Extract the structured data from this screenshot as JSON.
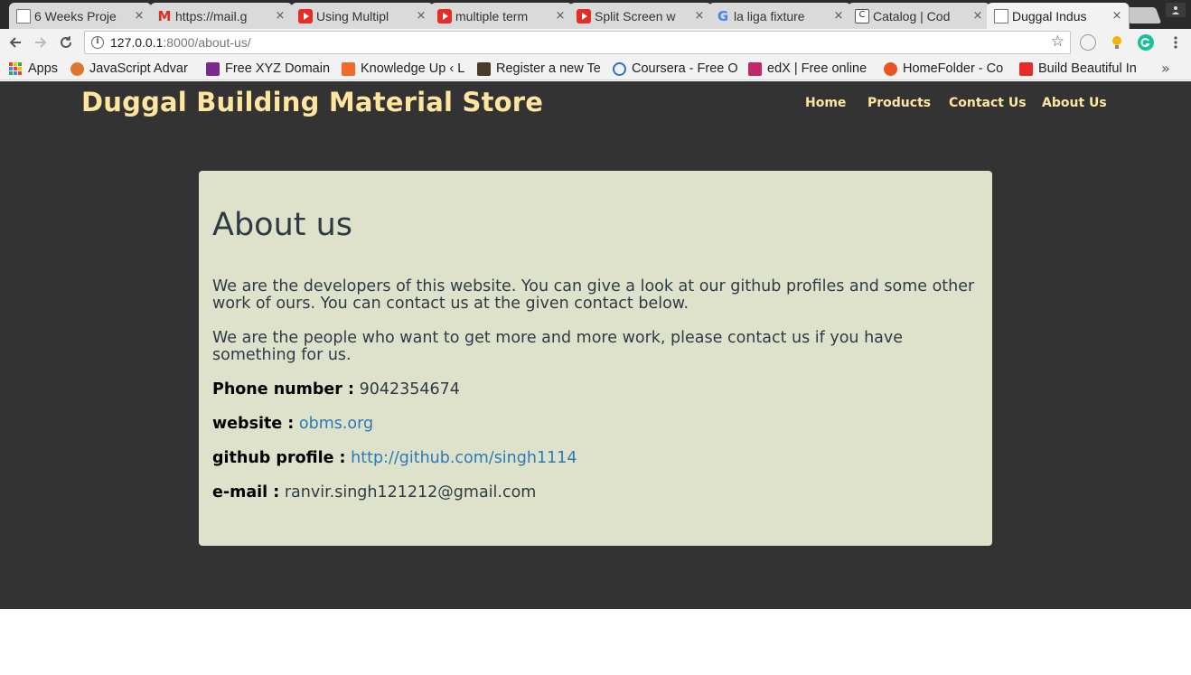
{
  "browser": {
    "tabs": [
      {
        "title": "6 Weeks Proje",
        "favicon": "document-icon",
        "active": false
      },
      {
        "title": "https://mail.g",
        "favicon": "gmail-icon",
        "active": false
      },
      {
        "title": "Using Multipl",
        "favicon": "youtube-icon",
        "active": false
      },
      {
        "title": "multiple term",
        "favicon": "youtube-icon",
        "active": false
      },
      {
        "title": "Split Screen w",
        "favicon": "youtube-icon",
        "active": false
      },
      {
        "title": "la liga fixture",
        "favicon": "google-icon",
        "active": false
      },
      {
        "title": "Catalog | Cod",
        "favicon": "catalog-icon",
        "active": false
      },
      {
        "title": "Duggal Indus",
        "favicon": "document-icon",
        "active": true
      }
    ],
    "close_glyph": "×",
    "address": {
      "host": "127.0.0.1",
      "path": ":8000/about-us/"
    },
    "bookmarks": [
      {
        "label": "Apps",
        "icon": "apps-grid-icon"
      },
      {
        "label": "JavaScript Advar",
        "icon": "fox-icon",
        "color": "#e0762b"
      },
      {
        "label": "Free XYZ Domain",
        "icon": "xyz-icon",
        "color": "#7a2a8a"
      },
      {
        "label": "Knowledge Up ‹ L",
        "icon": "knowledge-icon",
        "color": "#f06a2a"
      },
      {
        "label": "Register a new Te",
        "icon": "cc-icon",
        "color": "#4b3a2a"
      },
      {
        "label": "Coursera - Free O",
        "icon": "coursera-icon",
        "color": "#2a73cc"
      },
      {
        "label": "edX | Free online",
        "icon": "edx-icon",
        "color": "#c0286b"
      },
      {
        "label": "HomeFolder - Co",
        "icon": "ubuntu-icon",
        "color": "#e95420"
      },
      {
        "label": "Build Beautiful In",
        "icon": "youtube-icon",
        "color": "#e52d27"
      }
    ],
    "bookmarks_more": "»"
  },
  "site": {
    "brand": "Duggal Building Material Store",
    "nav": [
      "Home",
      "Products",
      "Contact Us",
      "About Us"
    ],
    "about": {
      "heading": "About us",
      "para1": "We are the developers of this website. You can give a look at our github profiles and some other work of ours. You can contact us at the given contact below.",
      "para2": "We are the people who want to get more and more work, please contact us if you have something for us.",
      "phone_label": "Phone number :",
      "phone_value": "9042354674",
      "website_label": "website :",
      "website_value": "obms.org",
      "github_label": "github profile :",
      "github_value": "http://github.com/singh1114",
      "email_label": "e-mail :",
      "email_value": "ranvir.singh121212@gmail.com"
    }
  },
  "colors": {
    "page_bg": "#333333",
    "brand_text": "#ffe6a0",
    "card_bg": "#dfe2cb",
    "body_text": "#2e3b47",
    "link": "#2a7ab6"
  }
}
